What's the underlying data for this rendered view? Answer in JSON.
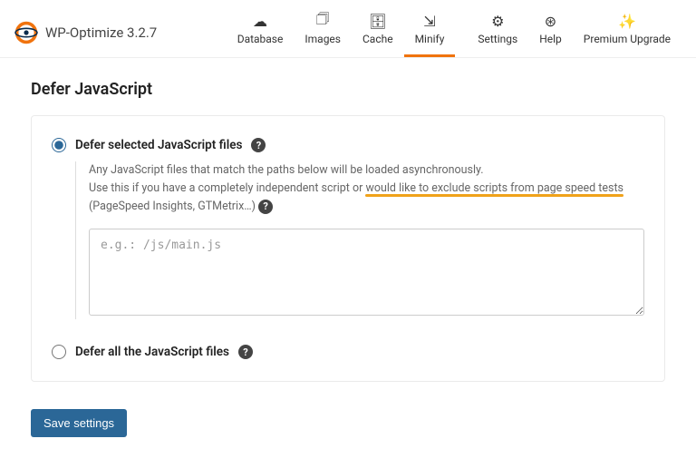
{
  "brand": {
    "name": "WP-Optimize 3.2.7"
  },
  "nav": {
    "items": [
      {
        "label": "Database",
        "icon": "cloud-icon"
      },
      {
        "label": "Images",
        "icon": "images-icon"
      },
      {
        "label": "Cache",
        "icon": "archive-icon"
      },
      {
        "label": "Minify",
        "icon": "compress-icon",
        "active": true
      },
      {
        "label": "Settings",
        "icon": "sliders-icon"
      },
      {
        "label": "Help",
        "icon": "lifebuoy-icon"
      },
      {
        "label": "Premium Upgrade",
        "icon": "wand-icon"
      }
    ]
  },
  "page_title": "Defer JavaScript",
  "option1": {
    "label": "Defer selected JavaScript files",
    "desc_line1": "Any JavaScript files that match the paths below will be loaded asynchronously.",
    "desc_line2a": "Use this if you have a completely independent script or ",
    "desc_line2b_highlight": "would like to exclude scripts from page speed tests",
    "desc_line3": "(PageSpeed Insights, GTMetrix…)",
    "placeholder": "e.g.: /js/main.js"
  },
  "option2": {
    "label": "Defer all the JavaScript files"
  },
  "save_button": "Save settings"
}
